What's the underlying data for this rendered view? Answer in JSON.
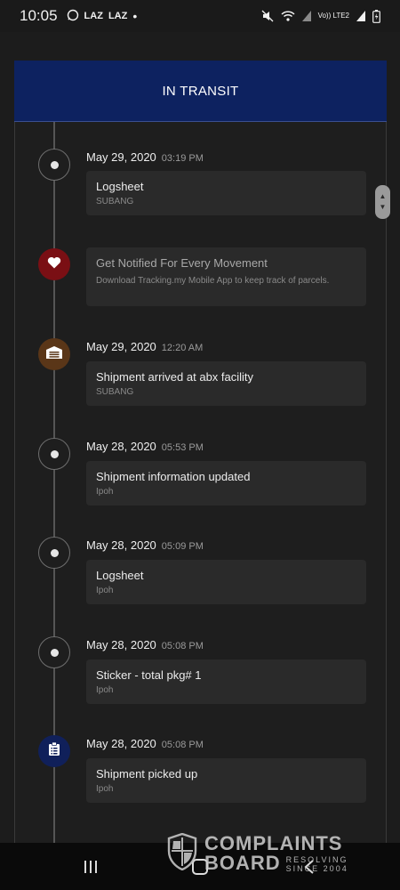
{
  "status_bar": {
    "time": "10:05",
    "app_icons": [
      "LAZ",
      "LAZ"
    ],
    "network_label": "Vo)) LTE2"
  },
  "header": {
    "title": "IN TRANSIT"
  },
  "promo": {
    "title": "Get Notified For Every Movement",
    "subtitle": "Download Tracking.my Mobile App to keep track of parcels."
  },
  "events": [
    {
      "date": "May 29, 2020",
      "time": "03:19 PM",
      "title": "Logsheet",
      "location": "SUBANG",
      "icon": "dot-icon"
    },
    {
      "date": "May 29, 2020",
      "time": "12:20 AM",
      "title": "Shipment arrived at abx facility",
      "location": "SUBANG",
      "icon": "garage-icon"
    },
    {
      "date": "May 28, 2020",
      "time": "05:53 PM",
      "title": "Shipment information updated",
      "location": "Ipoh",
      "icon": "dot-icon"
    },
    {
      "date": "May 28, 2020",
      "time": "05:09 PM",
      "title": "Logsheet",
      "location": "Ipoh",
      "icon": "dot-icon"
    },
    {
      "date": "May 28, 2020",
      "time": "05:08 PM",
      "title": "Sticker - total pkg# 1",
      "location": "Ipoh",
      "icon": "dot-icon"
    },
    {
      "date": "May 28, 2020",
      "time": "05:08 PM",
      "title": "Shipment picked up",
      "location": "Ipoh",
      "icon": "clipboard-icon"
    }
  ],
  "colors": {
    "header_bg": "#0d2260",
    "heart_node": "#7a0f14",
    "garage_node": "#5a3618",
    "clipboard_node": "#10205a"
  },
  "watermark": {
    "line1": "COMPLAINTS",
    "line2": "BOARD",
    "line3": "RESOLVING SINCE 2004"
  }
}
